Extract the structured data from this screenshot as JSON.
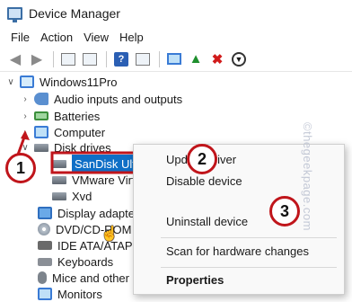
{
  "window": {
    "title": "Device Manager"
  },
  "menu": {
    "items": [
      "File",
      "Action",
      "View",
      "Help"
    ]
  },
  "toolbar": {
    "icons": [
      "back-arrow-icon",
      "forward-arrow-icon",
      "properties-icon",
      "view-icon",
      "help-icon",
      "refresh-icon",
      "computer-icon",
      "scan-icon",
      "update-driver-icon",
      "uninstall-icon",
      "disable-icon"
    ],
    "help_glyph": "?"
  },
  "tree": {
    "root": "Windows11Pro",
    "categories": {
      "audio": "Audio inputs and outputs",
      "batteries": "Batteries",
      "computer": "Computer",
      "disk_drives": "Disk drives",
      "display": "Display adapters",
      "dvd": "DVD/CD-ROM d",
      "ide": "IDE ATA/ATAPI c",
      "keyboards": "Keyboards",
      "mice": "Mice and other p",
      "monitors": "Monitors"
    },
    "disks": [
      "SanDisk Ultra USB Devic",
      "VMware Virtu",
      "Xvd"
    ]
  },
  "context_menu": {
    "items": [
      "Update driver",
      "Disable device",
      "Uninstall device",
      "Scan for hardware changes",
      "Properties"
    ]
  },
  "annotations": [
    "1",
    "2",
    "3"
  ],
  "watermark": "©thegeekpage.com",
  "colors": {
    "selection": "#0f6fc6",
    "annotation": "#c0151b"
  }
}
